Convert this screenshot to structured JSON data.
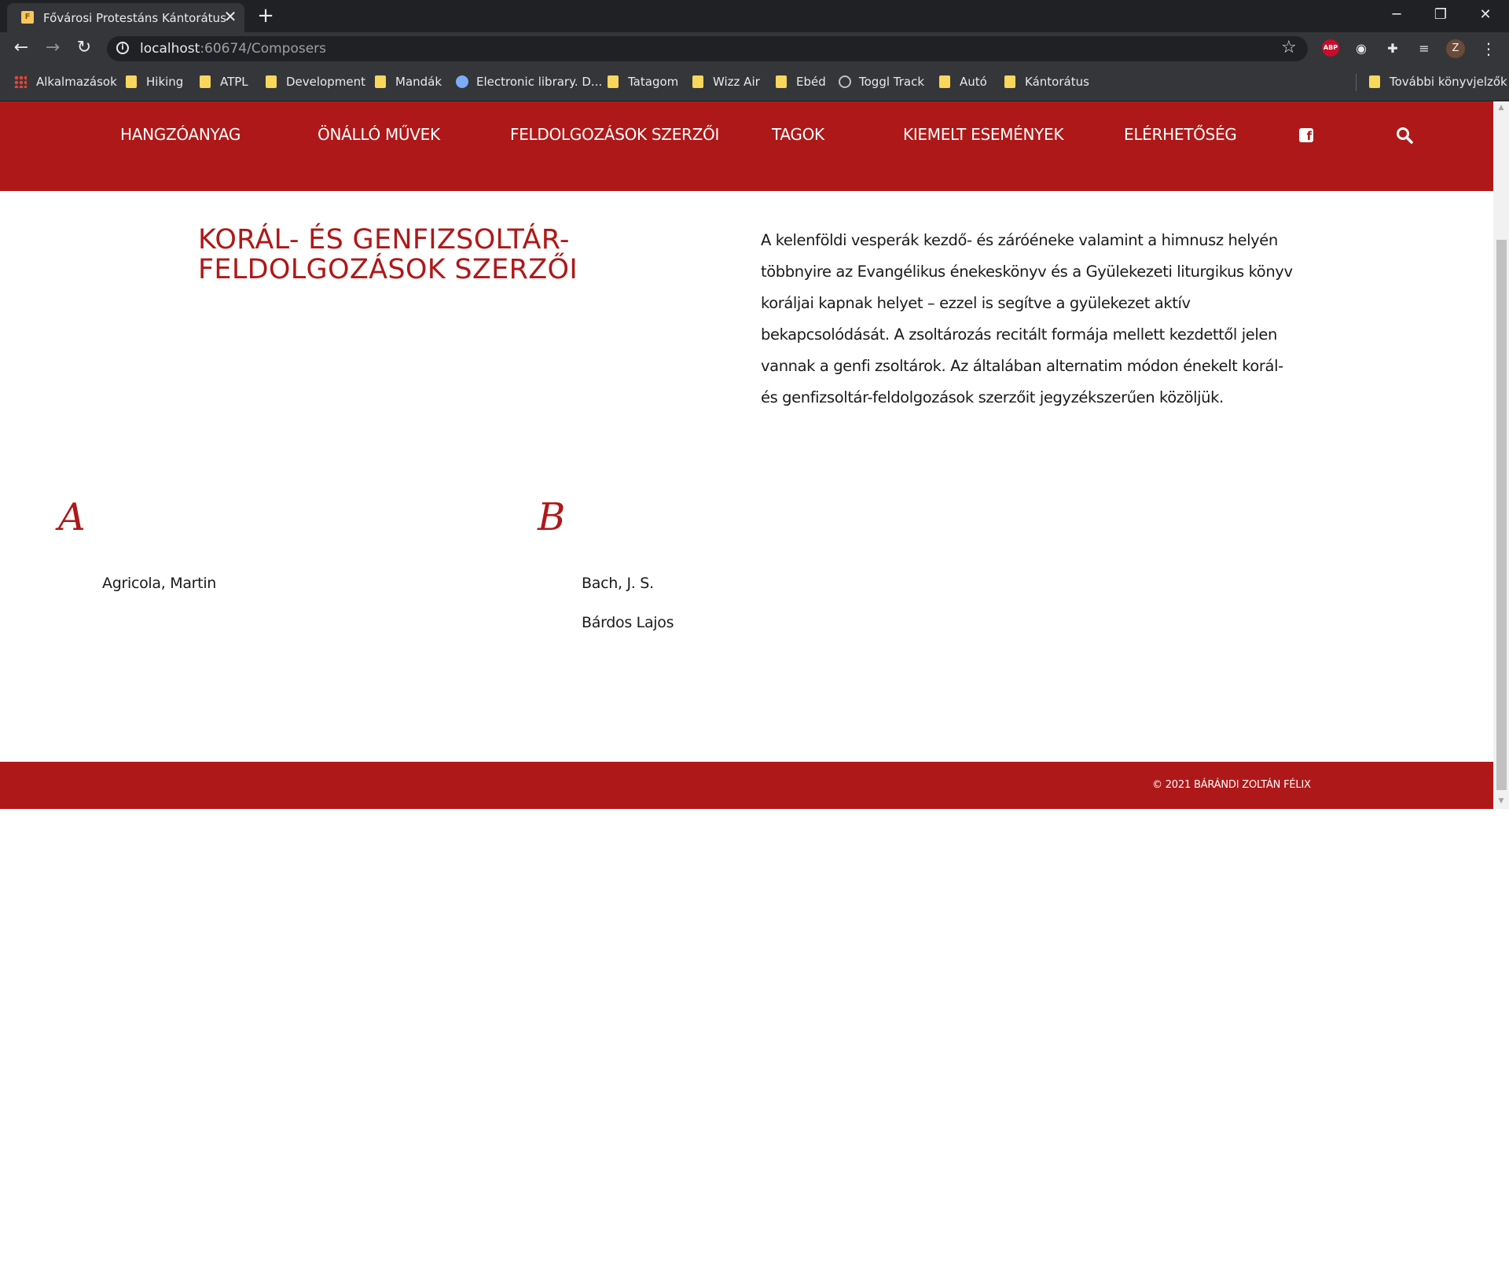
{
  "browser": {
    "tab_title": "Fővárosi Protestáns Kántorátus",
    "favicon_letter": "F",
    "url_host": "localhost",
    "url_path": ":60674/Composers",
    "profile_initial": "Z",
    "abp_label": "ABP",
    "bookmarks": [
      {
        "label": "Alkalmazások",
        "icon": "apps-icon"
      },
      {
        "label": "Hiking",
        "icon": "folder-icon"
      },
      {
        "label": "ATPL",
        "icon": "folder-icon"
      },
      {
        "label": "Development",
        "icon": "folder-icon"
      },
      {
        "label": "Mandák",
        "icon": "folder-icon"
      },
      {
        "label": "Electronic library. D...",
        "icon": "globe-icon"
      },
      {
        "label": "Tatagom",
        "icon": "folder-icon"
      },
      {
        "label": "Wizz Air",
        "icon": "folder-icon"
      },
      {
        "label": "Ebéd",
        "icon": "folder-icon"
      },
      {
        "label": "Toggl Track",
        "icon": "toggl-icon"
      },
      {
        "label": "Autó",
        "icon": "folder-icon"
      },
      {
        "label": "Kántorátus",
        "icon": "folder-icon"
      }
    ],
    "other_bookmarks": "További könyvjelzők"
  },
  "site": {
    "accent_color": "#af1818",
    "nav": [
      "HANGZÓANYAG",
      "ÖNÁLLÓ MŰVEK",
      "FELDOLGOZÁSOK SZERZŐI",
      "TAGOK",
      "KIEMELT ESEMÉNYEK",
      "ELÉRHETŐSÉG"
    ],
    "facebook_glyph": "f",
    "title": "KORÁL- ÉS GENFIZSOLTÁR-FELDOLGOZÁSOK SZERZŐI",
    "intro": "A kelenföldi vesperák kezdő- és záróéneke valamint a himnusz helyén többnyire az Evangélikus énekeskönyv és a Gyülekezeti liturgikus könyv koráljai kapnak helyet – ezzel is segítve a gyülekezet aktív bekapcsolódását. A zsoltározás recitált formája mellett kezdettől jelen vannak a genfi zsoltárok. Az általában alternatim módon énekelt korál- és genfizsoltár-feldolgozások szerzőit jegyzékszerűen közöljük.",
    "groups": [
      {
        "letter": "A",
        "composers": [
          "Agricola, Martin"
        ]
      },
      {
        "letter": "B",
        "composers": [
          "Bach, J. S.",
          "Bárdos Lajos"
        ]
      }
    ],
    "footer": "© 2021  BÁRÁNDI ZOLTÁN FÉLIX"
  }
}
